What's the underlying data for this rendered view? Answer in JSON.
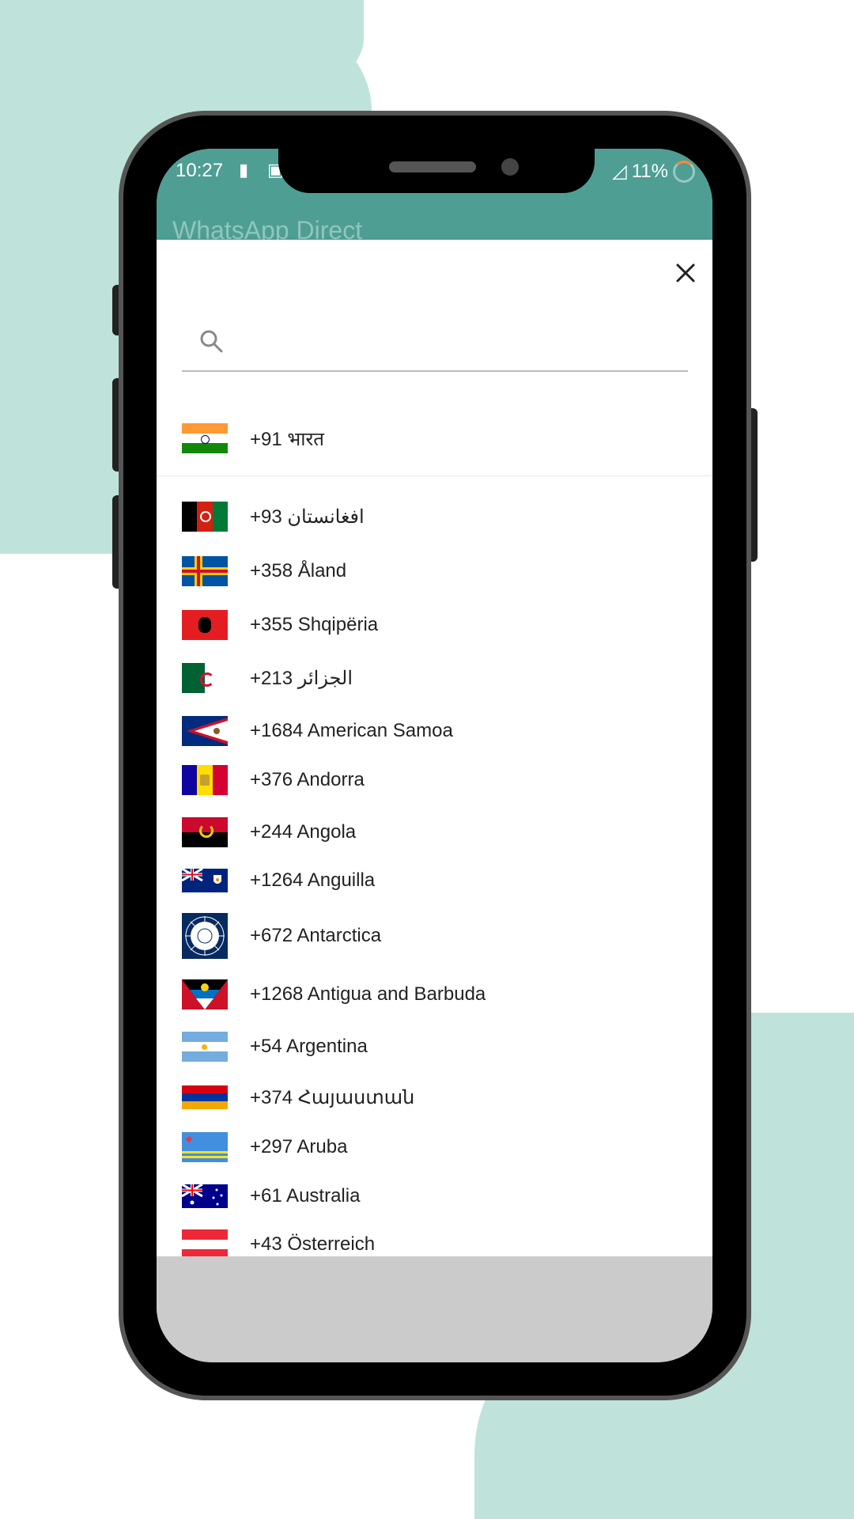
{
  "status_bar": {
    "time": "10:27",
    "battery_saver_icon": "battery-icon",
    "message_icon": "message-icon",
    "battery_percent": "11%",
    "signal_icon": "signal-icon"
  },
  "app_bar": {
    "title": "WhatsApp Direct"
  },
  "dialog": {
    "close_icon": "close-icon",
    "search_placeholder": "",
    "pinned": {
      "code": "+91 भारत",
      "flag": "India"
    },
    "countries": [
      {
        "label": "+93 افغانستان",
        "flag": "Afghanistan"
      },
      {
        "label": "+358 Åland",
        "flag": "Aland"
      },
      {
        "label": "+355 Shqipëria",
        "flag": "Albania"
      },
      {
        "label": "+213 الجزائر",
        "flag": "Algeria"
      },
      {
        "label": "+1684 American Samoa",
        "flag": "American Samoa"
      },
      {
        "label": "+376 Andorra",
        "flag": "Andorra"
      },
      {
        "label": "+244 Angola",
        "flag": "Angola"
      },
      {
        "label": "+1264 Anguilla",
        "flag": "Anguilla"
      },
      {
        "label": "+672 Antarctica",
        "flag": "Antarctica"
      },
      {
        "label": "+1268 Antigua and Barbuda",
        "flag": "Antigua and Barbuda"
      },
      {
        "label": "+54 Argentina",
        "flag": "Argentina"
      },
      {
        "label": "+374 Հայաստան",
        "flag": "Armenia"
      },
      {
        "label": "+297 Aruba",
        "flag": "Aruba"
      },
      {
        "label": "+61 Australia",
        "flag": "Australia"
      },
      {
        "label": "+43 Österreich",
        "flag": "Austria"
      }
    ]
  },
  "colors": {
    "accent": "#4e9e93",
    "background_paint": "#bfe3da"
  }
}
